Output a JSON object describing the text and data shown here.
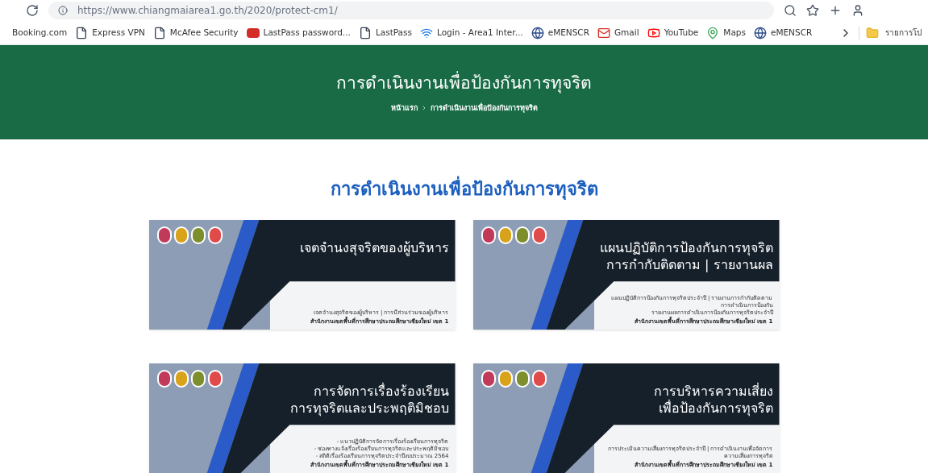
{
  "browser": {
    "url": "https://www.chiangmaiarea1.go.th/2020/protect-cm1/",
    "bookmarks": [
      {
        "label": "Booking.com",
        "kind": "none"
      },
      {
        "label": "Express VPN",
        "kind": "page"
      },
      {
        "label": "McAfee Security",
        "kind": "page"
      },
      {
        "label": "LastPass password...",
        "kind": "lastpass"
      },
      {
        "label": "LastPass",
        "kind": "page"
      },
      {
        "label": "Login - Area1 Inter...",
        "kind": "wifi"
      },
      {
        "label": "eMENSCR",
        "kind": "globe"
      },
      {
        "label": "Gmail",
        "kind": "gmail"
      },
      {
        "label": "YouTube",
        "kind": "youtube"
      },
      {
        "label": "Maps",
        "kind": "maps"
      },
      {
        "label": "eMENSCR",
        "kind": "globe"
      }
    ],
    "other_folder": "รายการโป"
  },
  "hero": {
    "title": "การดำเนินงานเพื่อป้องกันการทุจริต",
    "breadcrumb": [
      "หน้าแรก",
      "การดำเนินงานเพื่อป้องกันการทุจริต"
    ]
  },
  "section_title": "การดำเนินงานเพื่อป้องกันการทุจริต",
  "cards": [
    {
      "heading": [
        "เจตจำนงสุจริตของผู้บริหาร"
      ],
      "details": [
        "เจตจำนงสุจริตของผู้บริหาร | การมีส่วนร่วมของผู้บริหาร"
      ],
      "office": "สำนักงานเขตพื้นที่การศึกษาประถมศึกษาเชียงใหม่ เขต 1"
    },
    {
      "heading": [
        "แผนปฏิบัติการป้องกันการทุจริต",
        "การกำกับติดตาม | รายงานผล"
      ],
      "details": [
        "แผนปฏิบัติการป้องกันการทุจริตประจำปี | รายงานการกำกับติดตามการดำเนินการป้องกัน",
        "รายงานผลการดำเนินการป้องกันการทุจริตประจำปี"
      ],
      "office": "สำนักงานเขตพื้นที่การศึกษาประถมศึกษาเชียงใหม่ เขต 1"
    },
    {
      "heading": [
        "การจัดการเรื่องร้องเรียน",
        "การทุจริตและประพฤติมิชอบ"
      ],
      "details": [
        "- แนวปฏิบัติการจัดการเรื่องร้องเรียนการทุจริต",
        "- ช่องทางแจ้งเรื่องร้องเรียนการทุจริตและประพฤติมิชอบ",
        "- สถิติเรื่องร้องเรียนการทุจริตประจำปีงบประมาณ 2564"
      ],
      "office": "สำนักงานเขตพื้นที่การศึกษาประถมศึกษาเชียงใหม่ เขต 1"
    },
    {
      "heading": [
        "การบริหารความเสี่ยง",
        "เพื่อป้องกันการทุจริต"
      ],
      "details": [
        "การประเมินความเสี่ยงการทุจริตประจำปี | การดำเนินงานเพื่อจัดการความเสี่ยงการทุจริต"
      ],
      "office": "สำนักงานเขตพื้นที่การศึกษาประถมศึกษาเชียงใหม่ เขต 1"
    }
  ]
}
